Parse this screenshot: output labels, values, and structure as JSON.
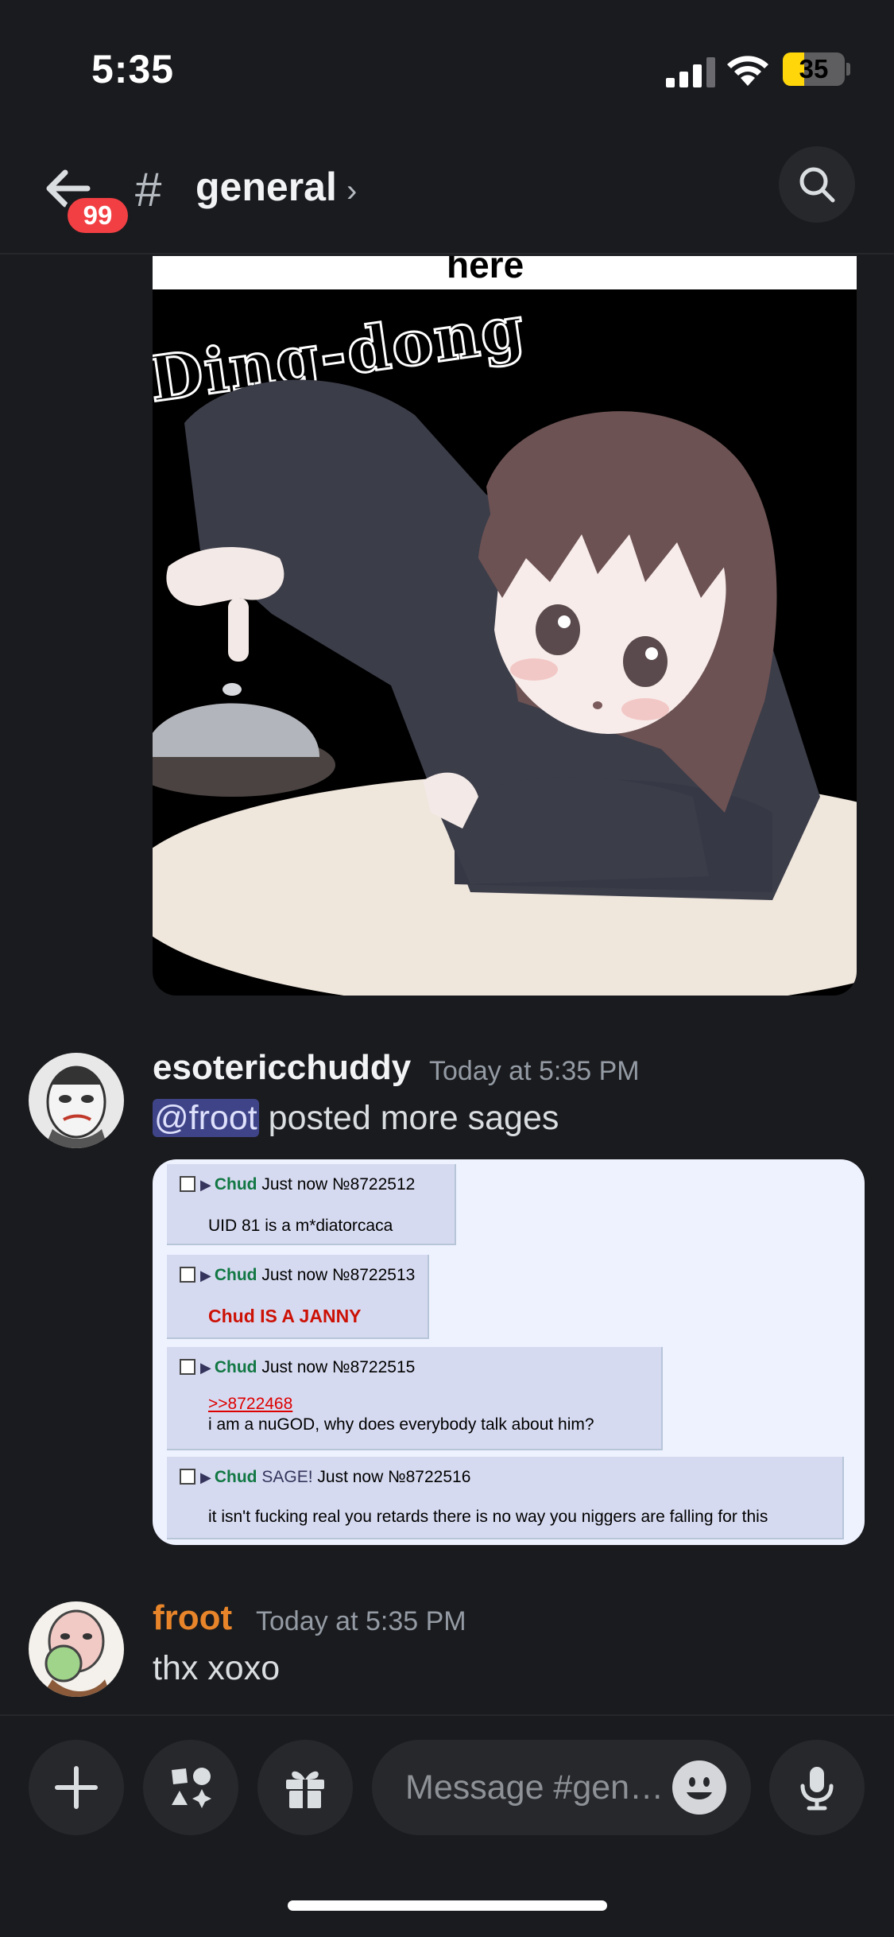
{
  "status_bar": {
    "time": "5:35",
    "battery": "35",
    "battery_fraction": 0.35
  },
  "header": {
    "mention_count": "99",
    "hash": "#",
    "channel": "general",
    "chevron": "›"
  },
  "image_attachment": {
    "top_text": "here",
    "caption": "Ding-dong"
  },
  "messages": [
    {
      "username": "esotericchuddy",
      "username_color": "#f2f3f5",
      "timestamp": "Today at 5:35 PM",
      "mention": "@froot",
      "text": " posted more sages",
      "embed_posts": [
        {
          "arrow": "▶",
          "name": "Chud",
          "sage": "",
          "meta": "Just now №8722512",
          "link": "",
          "body": "UID 81 is a m*diatorcaca",
          "body_style": "normal"
        },
        {
          "arrow": "▶",
          "name": "Chud",
          "sage": "",
          "meta": "Just now №8722513",
          "link": "",
          "body": "Chud IS A JANNY",
          "body_style": "red"
        },
        {
          "arrow": "▶",
          "name": "Chud",
          "sage": "",
          "meta": "Just now №8722515",
          "link": ">>8722468",
          "body": "i am a nuGOD, why does everybody talk about him?",
          "body_style": "normal"
        },
        {
          "arrow": "▶",
          "name": "Chud",
          "sage": "SAGE!",
          "meta": "Just now №8722516",
          "link": "",
          "body": "it isn't fucking real you retards there is no way you niggers are falling for this",
          "body_style": "normal"
        }
      ]
    },
    {
      "username": "froot",
      "username_color": "#e8852a",
      "timestamp": "Today at 5:35 PM",
      "text": "thx xoxo"
    }
  ],
  "composer": {
    "placeholder": "Message #gen…"
  },
  "icons": [
    "back-arrow-icon",
    "search-icon",
    "plus-icon",
    "apps-icon",
    "gift-icon",
    "emoji-icon",
    "microphone-icon",
    "signal-icon",
    "wifi-icon",
    "battery-icon"
  ]
}
